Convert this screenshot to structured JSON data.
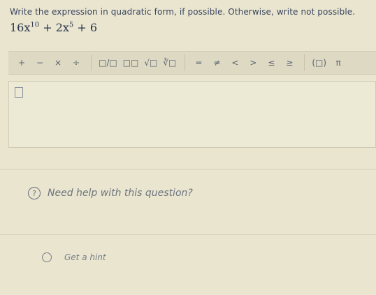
{
  "question": {
    "prompt": "Write the expression in quadratic form, if possible. Otherwise, write not possible.",
    "expression": {
      "term1_coef": "16x",
      "term1_exp": "10",
      "term2_coef": "+ 2x",
      "term2_exp": "5",
      "term3": "+ 6"
    }
  },
  "toolbar": {
    "buttons": [
      "+",
      "−",
      "×",
      "÷",
      "□/□",
      "□□",
      "√□",
      "∛□",
      "=",
      "≠",
      "<",
      ">",
      "≤",
      "≥",
      "(□)",
      "π"
    ]
  },
  "help": {
    "icon_text": "?",
    "label": "Need help with this question?"
  },
  "hint": {
    "label": "Get a hint"
  },
  "colors": {
    "background": "#e9e5cf",
    "text": "#2f3a4a",
    "toolbar": "#ddd9c3"
  }
}
